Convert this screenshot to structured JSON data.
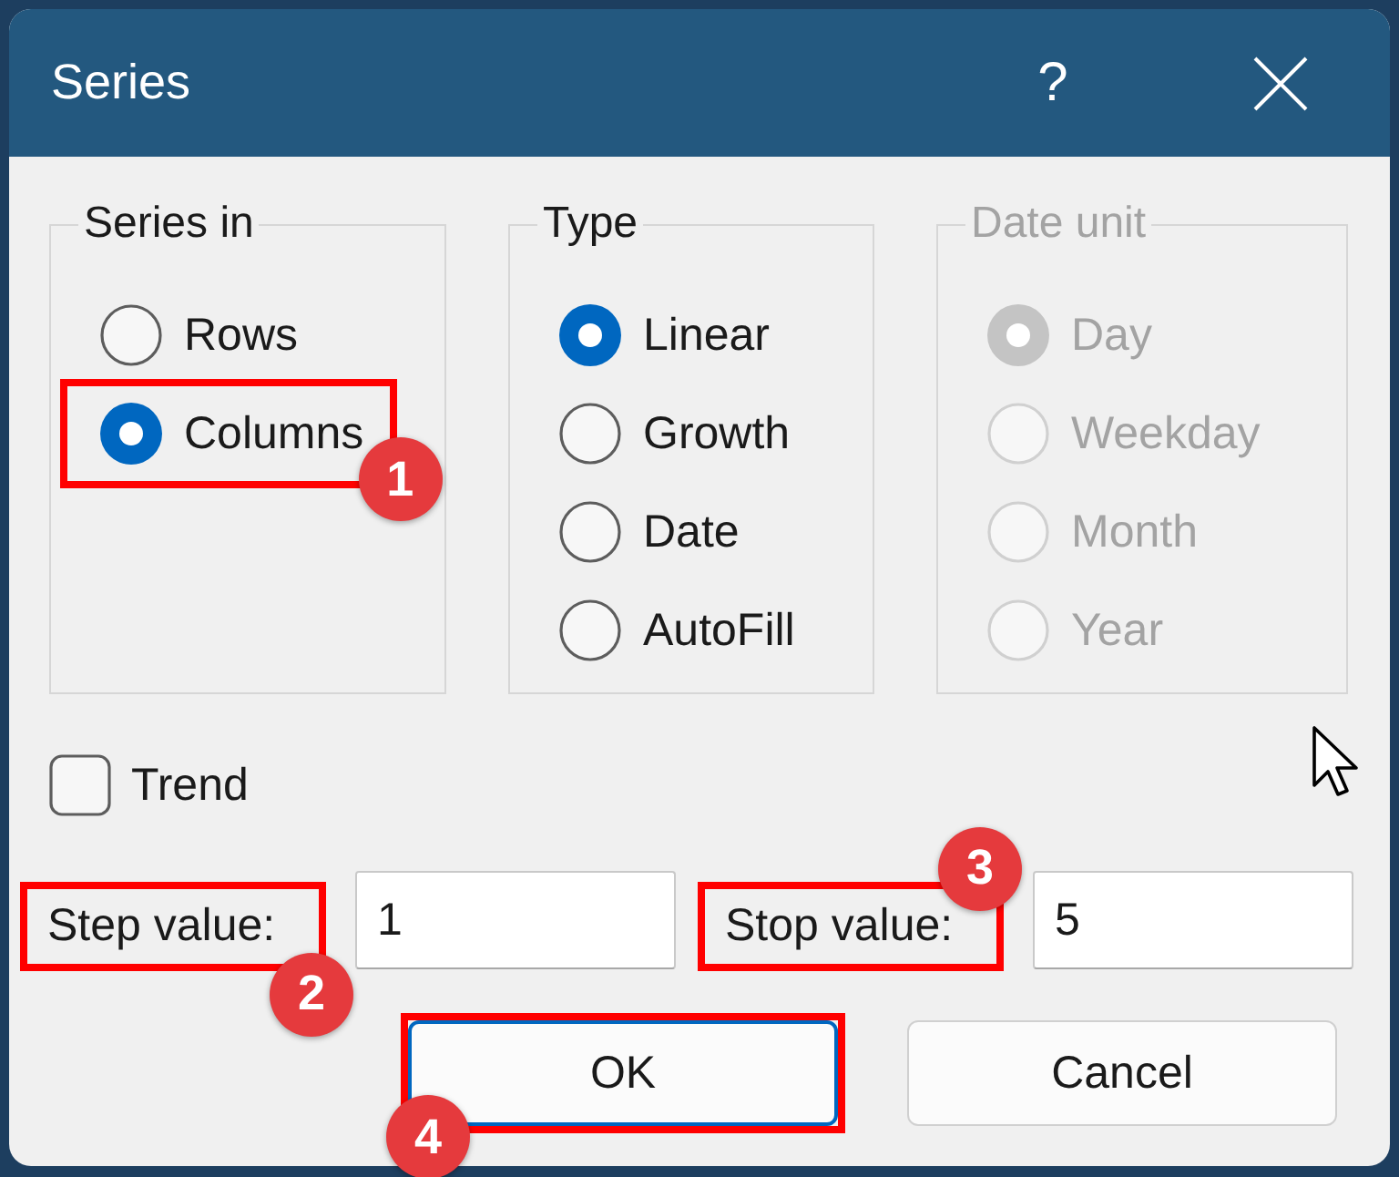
{
  "window": {
    "title": "Series",
    "help": "?"
  },
  "groups": [
    {
      "title": "Series in",
      "disabled": false,
      "options": [
        {
          "label": "Rows",
          "selected": false
        },
        {
          "label": "Columns",
          "selected": true,
          "callout": {
            "number": "1"
          }
        }
      ]
    },
    {
      "title": "Type",
      "disabled": false,
      "options": [
        {
          "label": "Linear",
          "selected": true
        },
        {
          "label": "Growth",
          "selected": false
        },
        {
          "label": "Date",
          "selected": false
        },
        {
          "label": "AutoFill",
          "selected": false
        }
      ]
    },
    {
      "title": "Date unit",
      "disabled": true,
      "options": [
        {
          "label": "Day",
          "selected": true
        },
        {
          "label": "Weekday",
          "selected": false
        },
        {
          "label": "Month",
          "selected": false
        },
        {
          "label": "Year",
          "selected": false
        }
      ]
    }
  ],
  "trend": {
    "label": "Trend",
    "checked": false
  },
  "fields": [
    {
      "label": "Step value:",
      "value": "1",
      "callout": {
        "number": "2"
      }
    },
    {
      "label": "Stop value:",
      "value": "5",
      "callout": {
        "number": "3"
      }
    }
  ],
  "buttons": [
    {
      "label": "OK",
      "default": true,
      "callout": {
        "number": "4"
      }
    },
    {
      "label": "Cancel",
      "default": false
    }
  ]
}
